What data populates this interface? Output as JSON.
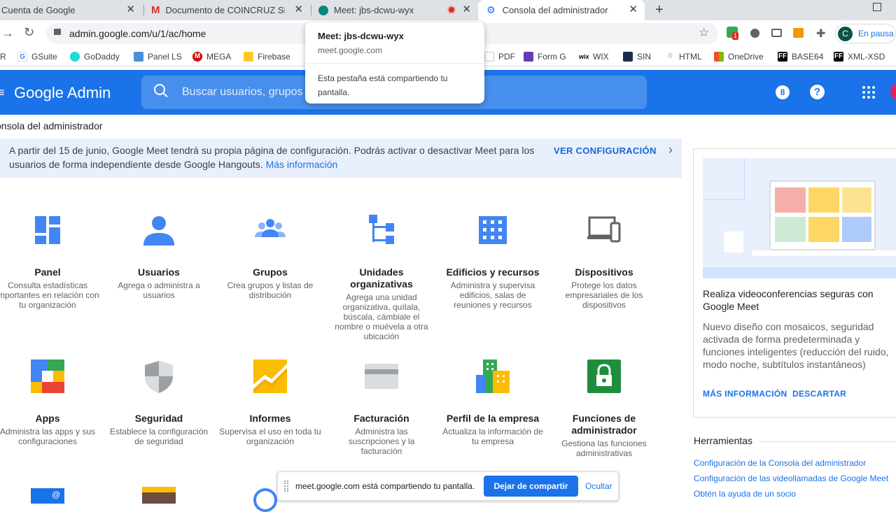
{
  "tabs": [
    {
      "title": "Cuenta de Google"
    },
    {
      "title": "Documento de COINCRUZ SRL -"
    },
    {
      "title": "Meet: jbs-dcwu-wyx"
    },
    {
      "title": "Consola del administrador"
    }
  ],
  "address": {
    "url": "admin.google.com/u/1/ac/home"
  },
  "profile": {
    "initial": "C",
    "status": "En pausa",
    "ext_badge": "1"
  },
  "bookmarks": [
    {
      "label": "R"
    },
    {
      "label": "GSuite"
    },
    {
      "label": "GoDaddy"
    },
    {
      "label": "Panel LS"
    },
    {
      "label": "MEGA"
    },
    {
      "label": "Firebase"
    },
    {
      "label": "PDF"
    },
    {
      "label": "Form G"
    },
    {
      "label": "WIX"
    },
    {
      "label": "SIN"
    },
    {
      "label": "HTML"
    },
    {
      "label": "OneDrive"
    },
    {
      "label": "BASE64"
    },
    {
      "label": "XML-XSD"
    }
  ],
  "meet_popup": {
    "title": "Meet: jbs-dcwu-wyx",
    "domain": "meet.google.com",
    "message": "Esta pestaña está compartiendo tu pantalla."
  },
  "header": {
    "logo": "Google Admin",
    "search_placeholder": "Buscar usuarios, grupos",
    "badge": "8"
  },
  "breadcrumb": "onsola del administrador",
  "banner": {
    "text": "A partir del 15 de junio, Google Meet tendrá su propia página de configuración. Podrás activar o desactivar Meet para los usuarios de forma independiente desde Google Hangouts.",
    "link": "Más información",
    "action": "VER CONFIGURACIÓN"
  },
  "cards": [
    {
      "title": "Panel",
      "desc": "Consulta estadísticas importantes en relación con tu organización"
    },
    {
      "title": "Usuarios",
      "desc": "Agrega o administra a usuarios"
    },
    {
      "title": "Grupos",
      "desc": "Crea grupos y listas de distribución"
    },
    {
      "title": "Unidades organizativas",
      "desc": "Agrega una unidad organizativa, quítala, búscala, cámbiale el nombre o muévela a otra ubicación"
    },
    {
      "title": "Edificios y recursos",
      "desc": "Administra y supervisa edificios, salas de reuniones y recursos"
    },
    {
      "title": "Dispositivos",
      "desc": "Protege los datos empresariales de los dispositivos"
    },
    {
      "title": "Apps",
      "desc": "Administra las apps y sus configuraciones"
    },
    {
      "title": "Seguridad",
      "desc": "Establece la configuración de seguridad"
    },
    {
      "title": "Informes",
      "desc": "Supervisa el uso en toda tu organización"
    },
    {
      "title": "Facturación",
      "desc": "Administra las suscripciones y la facturación"
    },
    {
      "title": "Perfil de la empresa",
      "desc": "Actualiza la información de tu empresa"
    },
    {
      "title": "Funciones de administrador",
      "desc": "Gestiona las funciones administrativas"
    }
  ],
  "promo": {
    "title": "Realiza videoconferencias seguras con Google Meet",
    "desc": "Nuevo diseño con mosaicos, seguridad activada de forma predeterminada y funciones inteligentes (reducción del ruido, modo noche, subtítulos instantáneos)",
    "more": "MÁS INFORMACIÓN",
    "dismiss": "DESCARTAR"
  },
  "tools": {
    "title": "Herramientas",
    "links": [
      "Configuración de la Consola del administrador",
      "Configuración de las videollamadas de Google Meet",
      "Obtén la ayuda de un socio"
    ]
  },
  "sharebar": {
    "message": "meet.google.com está compartiendo tu pantalla.",
    "stop": "Dejar de compartir",
    "hide": "Ocultar"
  },
  "colors": {
    "brand": "#1a73e8",
    "tabstrip": "#dee1e6",
    "banner": "#e8f0fe"
  }
}
